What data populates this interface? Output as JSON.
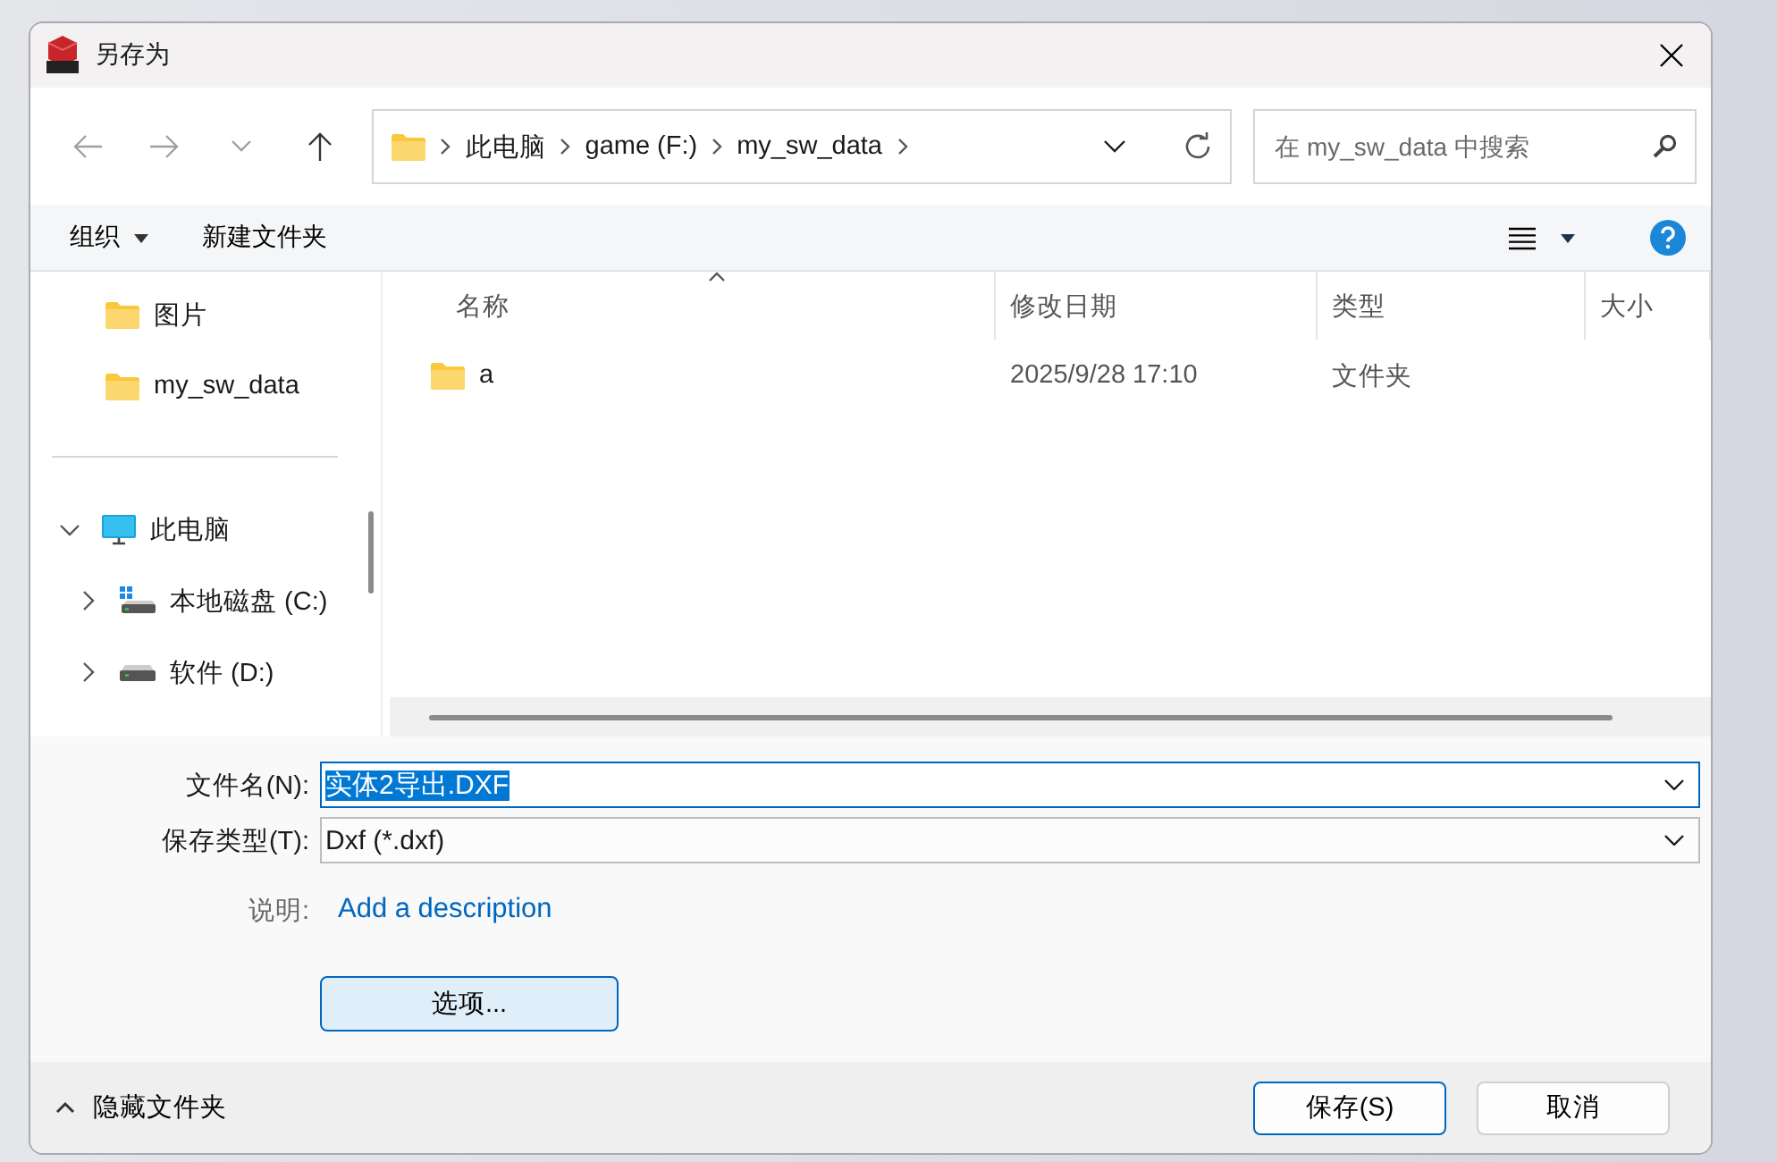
{
  "window": {
    "title": "另存为"
  },
  "nav": {
    "buttons": [
      {
        "kind": "back",
        "disabled": true
      },
      {
        "kind": "forward",
        "disabled": true
      },
      {
        "kind": "recent",
        "disabled": true
      },
      {
        "kind": "up",
        "disabled": false
      }
    ],
    "breadcrumb": [
      "此电脑",
      "game (F:)",
      "my_sw_data"
    ],
    "search": {
      "placeholder": "在 my_sw_data 中搜索"
    }
  },
  "toolbar": {
    "organize": "组织",
    "new_folder": "新建文件夹"
  },
  "sidebar": {
    "items": [
      {
        "kind": "folder",
        "label": "图片"
      },
      {
        "kind": "folder",
        "label": "my_sw_data"
      },
      {
        "kind": "separator"
      },
      {
        "kind": "pc",
        "label": "此电脑",
        "expanded": true,
        "children": [
          {
            "kind": "system_drive",
            "label": "本地磁盘 (C:)",
            "expanded": false
          },
          {
            "kind": "drive",
            "label": "软件 (D:)",
            "expanded": false
          }
        ]
      }
    ]
  },
  "table": {
    "columns": [
      {
        "label": "名称",
        "sorted": true
      },
      {
        "label": "修改日期"
      },
      {
        "label": "类型"
      },
      {
        "label": "大小"
      }
    ],
    "rows": [
      {
        "kind": "folder",
        "name": "a",
        "modified": "2025/9/28 17:10",
        "type": "文件夹"
      }
    ]
  },
  "form": {
    "file_name": {
      "label": "文件名(N):",
      "value": "实体2导出.DXF",
      "selected": true
    },
    "save_type": {
      "label": "保存类型(T):",
      "value": "Dxf (*.dxf)"
    },
    "description": {
      "label": "说明:",
      "link": "Add a description"
    },
    "options_button": "选项..."
  },
  "footer": {
    "hide_folders": "隐藏文件夹",
    "buttons": [
      {
        "label": "保存(S)",
        "default": true
      },
      {
        "label": "取消",
        "default": false
      }
    ]
  }
}
